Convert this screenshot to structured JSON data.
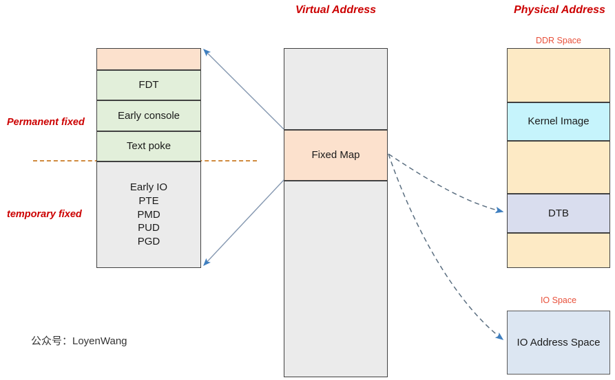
{
  "headings": {
    "virtual_address": "Virtual Address",
    "physical_address": "Physical Address"
  },
  "sublabels": {
    "ddr_space": "DDR Space",
    "io_space": "IO Space"
  },
  "side_labels": {
    "permanent_fixed": "Permanent fixed",
    "temporary_fixed": "temporary fixed"
  },
  "virtual_fixmap_stack": {
    "segments": [
      {
        "label": "",
        "color": "#fce1cd",
        "kind": "peach"
      },
      {
        "label": "FDT",
        "color": "#e2efda",
        "kind": "green"
      },
      {
        "label": "Early console",
        "color": "#e2efda",
        "kind": "green"
      },
      {
        "label": "Text poke",
        "color": "#e2efda",
        "kind": "green"
      },
      {
        "label": "Early IO\nPTE\nPMD\nPUD\nPGD",
        "color": "#ebebeb",
        "kind": "gray"
      }
    ],
    "temporary_lines": [
      "Early IO",
      "PTE",
      "PMD",
      "PUD",
      "PGD"
    ]
  },
  "virtual_address_space": {
    "segments": [
      {
        "label": "",
        "color": "#ebebeb"
      },
      {
        "label": "Fixed Map",
        "color": "#fce1cd"
      },
      {
        "label": "",
        "color": "#ebebeb"
      }
    ],
    "fixed_map_label": "Fixed Map"
  },
  "ddr_space": {
    "segments": [
      {
        "label": "",
        "color": "#fdeac5"
      },
      {
        "label": "Kernel Image",
        "color": "#c6f4fc"
      },
      {
        "label": "",
        "color": "#fdeac5"
      },
      {
        "label": "DTB",
        "color": "#d9ddee"
      },
      {
        "label": "",
        "color": "#fdeac5"
      }
    ]
  },
  "io_space": {
    "label": "IO Address Space",
    "color": "#dce6f2"
  },
  "watermark": "公众号：LoyenWang",
  "colors": {
    "heading_red": "#cc0000",
    "sublabel_red": "#e8503a",
    "arrow_solid": "#8497b0",
    "arrow_dashed": "#5a6e80",
    "dash_separator": "#d08a3e",
    "box_border": "#595959"
  }
}
